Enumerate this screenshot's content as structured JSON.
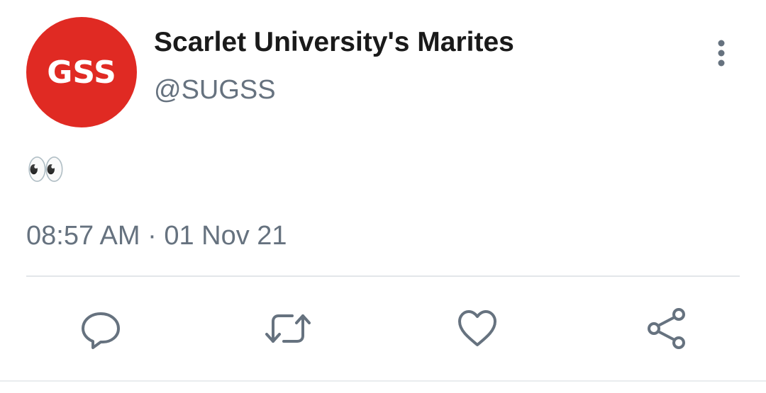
{
  "tweet": {
    "avatar_text": "GSS",
    "display_name": "Scarlet University's Marites",
    "handle": "@SUGSS",
    "body": "👀",
    "timestamp": "08:57 AM · 01 Nov 21"
  },
  "actions": {
    "reply_icon": "reply-icon",
    "retweet_icon": "retweet-icon",
    "like_icon": "like-icon",
    "share_icon": "share-icon",
    "more_icon": "more-vertical-icon"
  },
  "colors": {
    "avatar_bg": "#e02a23",
    "secondary_text": "#66727f",
    "icon": "#66727f",
    "primary_text": "#1a1a1a",
    "divider": "#e3e6e9"
  }
}
